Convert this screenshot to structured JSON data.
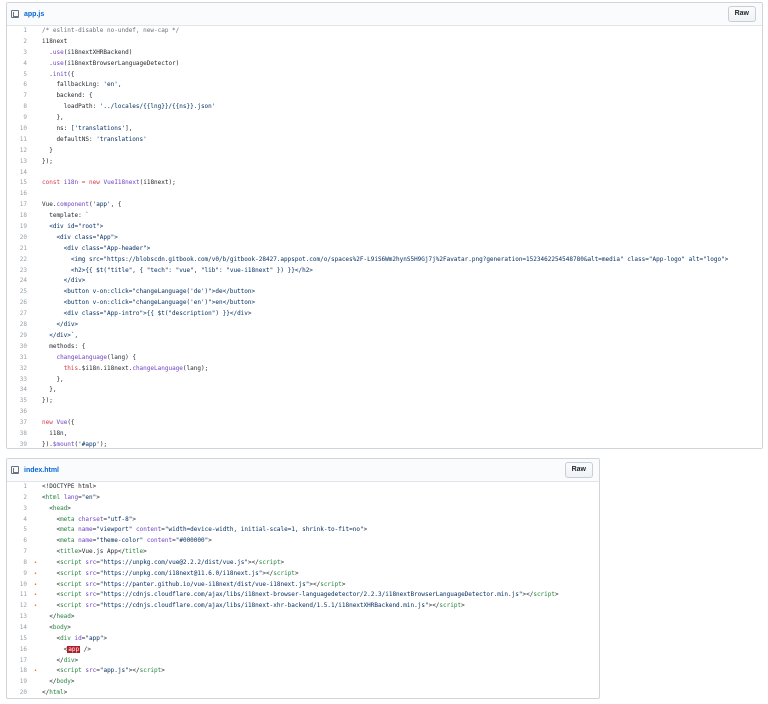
{
  "files": [
    {
      "id": "app",
      "name": "app.js",
      "raw_label": "Raw",
      "lines": [
        [
          {
            "t": "/* eslint-disable no-undef, new-cap */",
            "c": "cm"
          }
        ],
        [
          {
            "t": "i18next"
          }
        ],
        [
          {
            "t": "  ."
          },
          {
            "t": "use",
            "c": "fn"
          },
          {
            "t": "(i18nextXHRBackend)"
          }
        ],
        [
          {
            "t": "  ."
          },
          {
            "t": "use",
            "c": "fn"
          },
          {
            "t": "(i18nextBrowserLanguageDetector)"
          }
        ],
        [
          {
            "t": "  ."
          },
          {
            "t": "init",
            "c": "fn"
          },
          {
            "t": "({"
          }
        ],
        [
          {
            "t": "    fallbackLng: "
          },
          {
            "t": "'en'",
            "c": "st"
          },
          {
            "t": ","
          }
        ],
        [
          {
            "t": "    backend: {"
          }
        ],
        [
          {
            "t": "      loadPath: "
          },
          {
            "t": "'../locales/{{lng}}/{{ns}}.json'",
            "c": "st"
          }
        ],
        [
          {
            "t": "    },"
          }
        ],
        [
          {
            "t": "    ns: ["
          },
          {
            "t": "'translations'",
            "c": "st"
          },
          {
            "t": "],"
          }
        ],
        [
          {
            "t": "    defaultNS: "
          },
          {
            "t": "'translations'",
            "c": "st"
          }
        ],
        [
          {
            "t": "  }"
          }
        ],
        [
          {
            "t": "});"
          }
        ],
        [
          {
            "t": ""
          }
        ],
        [
          {
            "t": "const",
            "c": "kw"
          },
          {
            "t": " "
          },
          {
            "t": "i18n",
            "c": "fn"
          },
          {
            "t": " "
          },
          {
            "t": "=",
            "c": "kw"
          },
          {
            "t": " "
          },
          {
            "t": "new",
            "c": "kw"
          },
          {
            "t": " "
          },
          {
            "t": "VueI18next",
            "c": "fn"
          },
          {
            "t": "(i18next);"
          }
        ],
        [
          {
            "t": ""
          }
        ],
        [
          {
            "t": "Vue."
          },
          {
            "t": "component",
            "c": "fn"
          },
          {
            "t": "("
          },
          {
            "t": "'app'",
            "c": "st"
          },
          {
            "t": ", {"
          }
        ],
        [
          {
            "t": "  template: "
          },
          {
            "t": "`",
            "c": "st"
          }
        ],
        [
          {
            "t": "  <div id=\"root\">",
            "c": "st"
          }
        ],
        [
          {
            "t": "    <div class=\"App\">",
            "c": "st"
          }
        ],
        [
          {
            "t": "      <div class=\"App-header\">",
            "c": "st"
          }
        ],
        [
          {
            "t": "        <img src=\"https://blobscdn.gitbook.com/v0/b/gitbook-28427.appspot.com/o/spaces%2F-L9iS6Wm2hynS5H9Gj7j%2Favatar.png?generation=1523462254548780&alt=media\" class=\"App-logo\" alt=\"logo\">",
            "c": "st"
          }
        ],
        [
          {
            "t": "        <h2>{{ $t(\"title\", { \"tech\": \"vue\", \"lib\": \"vue-i18next\" }) }}</h2>",
            "c": "st"
          }
        ],
        [
          {
            "t": "      </div>",
            "c": "st"
          }
        ],
        [
          {
            "t": "      <button v-on:click=\"changeLanguage('de')\">de</button>",
            "c": "st"
          }
        ],
        [
          {
            "t": "      <button v-on:click=\"changeLanguage('en')\">en</button>",
            "c": "st"
          }
        ],
        [
          {
            "t": "      <div class=\"App-intro\">{{ $t(\"description\") }}</div>",
            "c": "st"
          }
        ],
        [
          {
            "t": "    </div>",
            "c": "st"
          }
        ],
        [
          {
            "t": "  </div>`",
            "c": "st"
          },
          {
            "t": ","
          }
        ],
        [
          {
            "t": "  methods: {"
          }
        ],
        [
          {
            "t": "    "
          },
          {
            "t": "changeLanguage",
            "c": "fn"
          },
          {
            "t": "(lang) {"
          }
        ],
        [
          {
            "t": "      "
          },
          {
            "t": "this",
            "c": "kw"
          },
          {
            "t": ".$i18n.i18next."
          },
          {
            "t": "changeLanguage",
            "c": "fn"
          },
          {
            "t": "(lang);"
          }
        ],
        [
          {
            "t": "    },"
          }
        ],
        [
          {
            "t": "  },"
          }
        ],
        [
          {
            "t": "});"
          }
        ],
        [
          {
            "t": ""
          }
        ],
        [
          {
            "t": "new",
            "c": "kw"
          },
          {
            "t": " "
          },
          {
            "t": "Vue",
            "c": "fn"
          },
          {
            "t": "({"
          }
        ],
        [
          {
            "t": "  i18n,"
          }
        ],
        [
          {
            "t": "})."
          },
          {
            "t": "$mount",
            "c": "fn"
          },
          {
            "t": "("
          },
          {
            "t": "'#app'",
            "c": "st"
          },
          {
            "t": ");"
          }
        ]
      ]
    },
    {
      "id": "index",
      "name": "index.html",
      "raw_label": "Raw",
      "lines": [
        [
          {
            "t": "<!DOCTYPE html>"
          }
        ],
        [
          {
            "t": "<"
          },
          {
            "t": "html",
            "c": "nt"
          },
          {
            "t": " "
          },
          {
            "t": "lang",
            "c": "at"
          },
          {
            "t": "="
          },
          {
            "t": "\"en\"",
            "c": "st"
          },
          {
            "t": ">"
          }
        ],
        [
          {
            "t": "  <"
          },
          {
            "t": "head",
            "c": "nt"
          },
          {
            "t": ">"
          }
        ],
        [
          {
            "t": "    <"
          },
          {
            "t": "meta",
            "c": "nt"
          },
          {
            "t": " "
          },
          {
            "t": "charset",
            "c": "at"
          },
          {
            "t": "="
          },
          {
            "t": "\"utf-8\"",
            "c": "st"
          },
          {
            "t": ">"
          }
        ],
        [
          {
            "t": "    <"
          },
          {
            "t": "meta",
            "c": "nt"
          },
          {
            "t": " "
          },
          {
            "t": "name",
            "c": "at"
          },
          {
            "t": "="
          },
          {
            "t": "\"viewport\"",
            "c": "st"
          },
          {
            "t": " "
          },
          {
            "t": "content",
            "c": "at"
          },
          {
            "t": "="
          },
          {
            "t": "\"width=device-width, initial-scale=1, shrink-to-fit=no\"",
            "c": "st"
          },
          {
            "t": ">"
          }
        ],
        [
          {
            "t": "    <"
          },
          {
            "t": "meta",
            "c": "nt"
          },
          {
            "t": " "
          },
          {
            "t": "name",
            "c": "at"
          },
          {
            "t": "="
          },
          {
            "t": "\"theme-color\"",
            "c": "st"
          },
          {
            "t": " "
          },
          {
            "t": "content",
            "c": "at"
          },
          {
            "t": "="
          },
          {
            "t": "\"#000000\"",
            "c": "st"
          },
          {
            "t": ">"
          }
        ],
        [
          {
            "t": "    <"
          },
          {
            "t": "title",
            "c": "nt"
          },
          {
            "t": ">Vue.js App</"
          },
          {
            "t": "title",
            "c": "nt"
          },
          {
            "t": ">"
          }
        ],
        [
          {
            "t": "    <"
          },
          {
            "t": "script",
            "c": "nt"
          },
          {
            "t": " "
          },
          {
            "t": "src",
            "c": "at"
          },
          {
            "t": "="
          },
          {
            "t": "\"https://unpkg.com/vue@2.2.2/dist/vue.js\"",
            "c": "st"
          },
          {
            "t": "></"
          },
          {
            "t": "script",
            "c": "nt"
          },
          {
            "t": ">"
          }
        ],
        [
          {
            "t": "    <"
          },
          {
            "t": "script",
            "c": "nt"
          },
          {
            "t": " "
          },
          {
            "t": "src",
            "c": "at"
          },
          {
            "t": "="
          },
          {
            "t": "\"https://unpkg.com/i18next@11.6.0/i18next.js\"",
            "c": "st"
          },
          {
            "t": "></"
          },
          {
            "t": "script",
            "c": "nt"
          },
          {
            "t": ">"
          }
        ],
        [
          {
            "t": "    <"
          },
          {
            "t": "script",
            "c": "nt"
          },
          {
            "t": " "
          },
          {
            "t": "src",
            "c": "at"
          },
          {
            "t": "="
          },
          {
            "t": "\"https://panter.github.io/vue-i18next/dist/vue-i18next.js\"",
            "c": "st"
          },
          {
            "t": "></"
          },
          {
            "t": "script",
            "c": "nt"
          },
          {
            "t": ">"
          }
        ],
        [
          {
            "t": "    <"
          },
          {
            "t": "script",
            "c": "nt"
          },
          {
            "t": " "
          },
          {
            "t": "src",
            "c": "at"
          },
          {
            "t": "="
          },
          {
            "t": "\"https://cdnjs.cloudflare.com/ajax/libs/i18next-browser-languagedetector/2.2.3/i18nextBrowserLanguageDetector.min.js\"",
            "c": "st"
          },
          {
            "t": "></"
          },
          {
            "t": "script",
            "c": "nt"
          },
          {
            "t": ">"
          }
        ],
        [
          {
            "t": "    <"
          },
          {
            "t": "script",
            "c": "nt"
          },
          {
            "t": " "
          },
          {
            "t": "src",
            "c": "at"
          },
          {
            "t": "="
          },
          {
            "t": "\"https://cdnjs.cloudflare.com/ajax/libs/i18next-xhr-backend/1.5.1/i18nextXHRBackend.min.js\"",
            "c": "st"
          },
          {
            "t": "></"
          },
          {
            "t": "script",
            "c": "nt"
          },
          {
            "t": ">"
          }
        ],
        [
          {
            "t": "  </"
          },
          {
            "t": "head",
            "c": "nt"
          },
          {
            "t": ">"
          }
        ],
        [
          {
            "t": "  <"
          },
          {
            "t": "body",
            "c": "nt"
          },
          {
            "t": ">"
          }
        ],
        [
          {
            "t": "    <"
          },
          {
            "t": "div",
            "c": "nt"
          },
          {
            "t": " "
          },
          {
            "t": "id",
            "c": "at"
          },
          {
            "t": "="
          },
          {
            "t": "\"app\"",
            "c": "st"
          },
          {
            "t": ">"
          }
        ],
        [
          {
            "t": "      <"
          },
          {
            "t": "app",
            "c": "hl"
          },
          {
            "t": " />"
          }
        ],
        [
          {
            "t": "    </"
          },
          {
            "t": "div",
            "c": "nt"
          },
          {
            "t": ">"
          }
        ],
        [
          {
            "t": "    <"
          },
          {
            "t": "script",
            "c": "nt"
          },
          {
            "t": " "
          },
          {
            "t": "src",
            "c": "at"
          },
          {
            "t": "="
          },
          {
            "t": "\"app.js\"",
            "c": "st"
          },
          {
            "t": "></"
          },
          {
            "t": "script",
            "c": "nt"
          },
          {
            "t": ">"
          }
        ],
        [
          {
            "t": "  </"
          },
          {
            "t": "body",
            "c": "nt"
          },
          {
            "t": ">"
          }
        ],
        [
          {
            "t": "</"
          },
          {
            "t": "html",
            "c": "nt"
          },
          {
            "t": ">"
          }
        ]
      ],
      "markers": [
        8,
        9,
        10,
        11,
        12,
        18
      ],
      "marker_glyph": "•"
    }
  ]
}
